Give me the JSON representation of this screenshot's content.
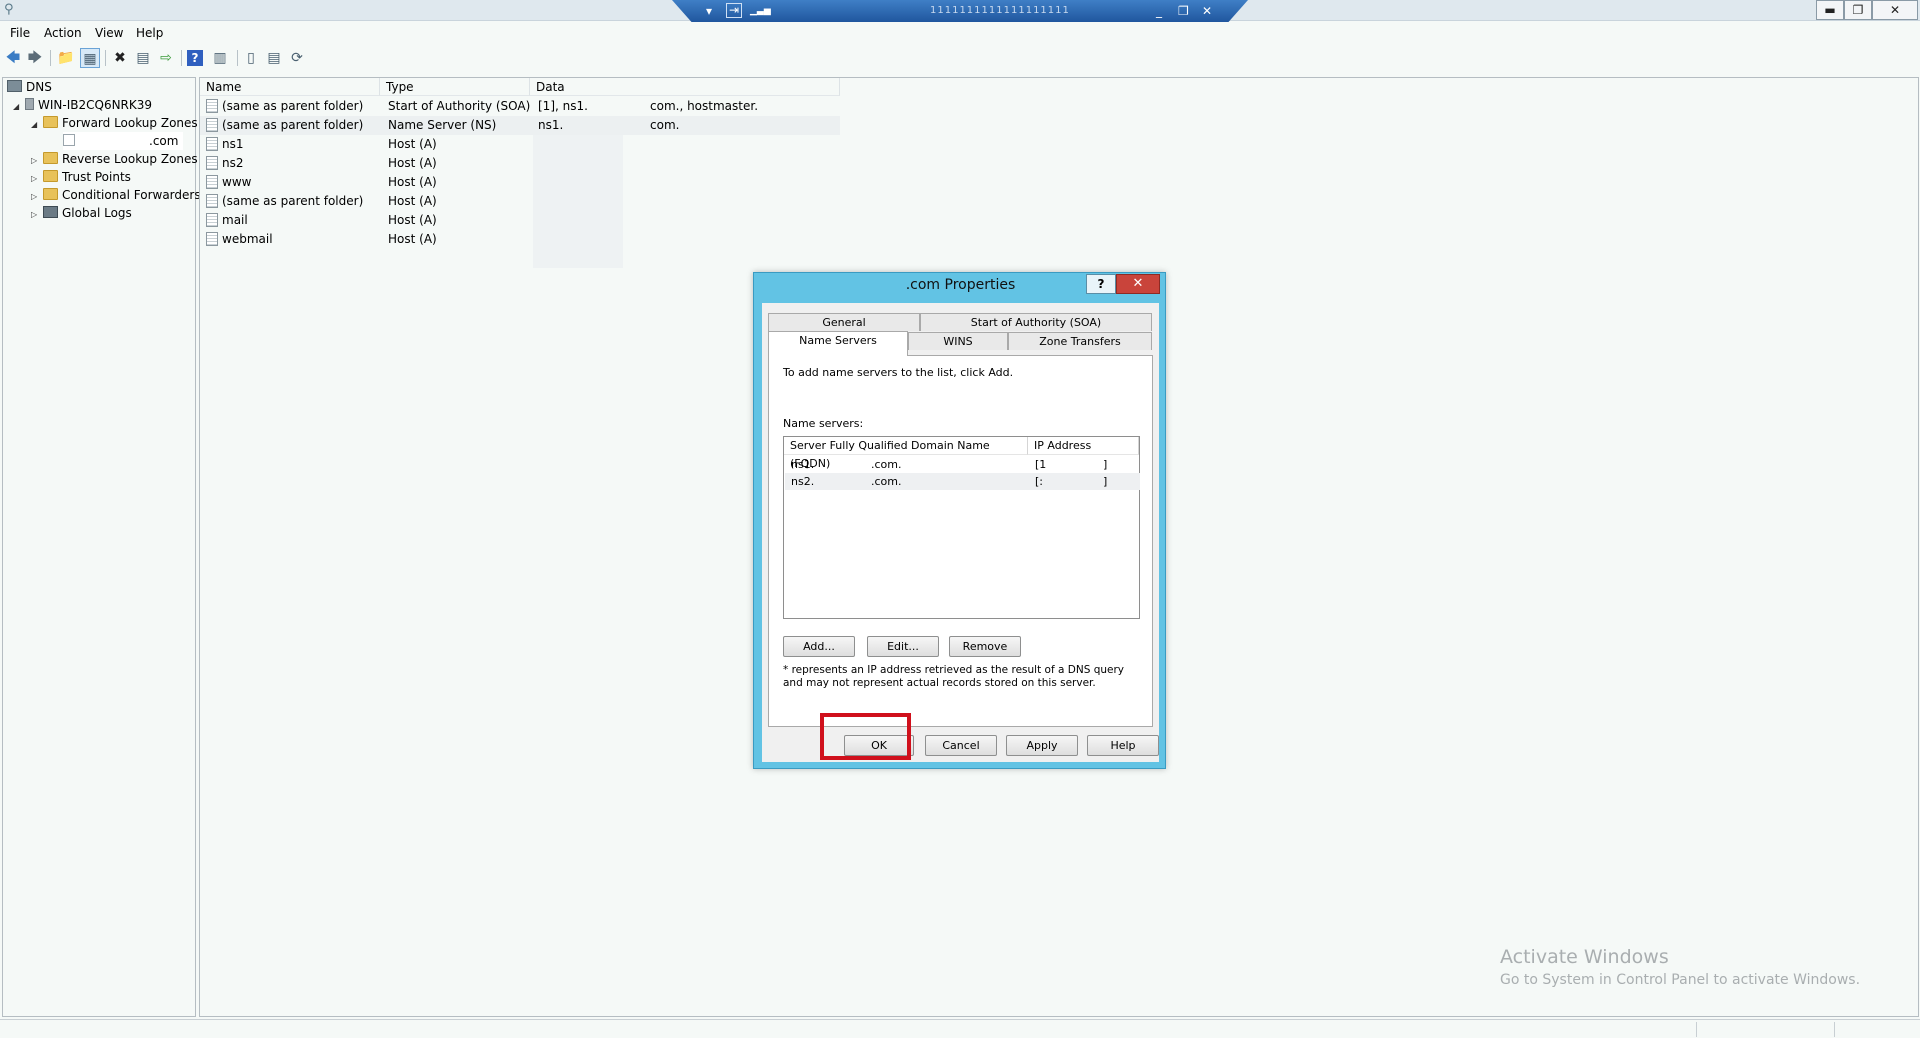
{
  "window": {
    "title_redacted": "1111111111111111111",
    "controls": {
      "minimize": "▬",
      "restore": "❐",
      "close": "✕"
    }
  },
  "rdp_bar": {
    "pin": "▾",
    "pin2": "⇥",
    "signal": "▁▃▅",
    "min": "_",
    "restore": "❐",
    "close": "✕"
  },
  "menu": {
    "file": "File",
    "action": "Action",
    "view": "View",
    "help": "Help"
  },
  "toolbar": {
    "back": "🡄",
    "forward": "🡆",
    "up": "📁",
    "show": "▦",
    "delete": "✖",
    "props": "▤",
    "export": "⇨",
    "help": "?",
    "console": "▥",
    "server": "▯",
    "list": "▤",
    "refresh": "⟳"
  },
  "tree": {
    "root": "DNS",
    "server": "WIN-IB2CQ6NRK39",
    "forward_zones": "Forward Lookup Zones",
    "zone": ".com",
    "reverse_zones": "Reverse Lookup Zones",
    "trust_points": "Trust Points",
    "conditional_forwarders": "Conditional Forwarders",
    "global_logs": "Global Logs",
    "expanded": "◢",
    "collapsed": "▷"
  },
  "list": {
    "columns": {
      "name": "Name",
      "type": "Type",
      "data": "Data"
    },
    "rows": [
      {
        "name": "(same as parent folder)",
        "type": "Start of Authority (SOA)",
        "data_a": "[1], ns1.",
        "data_b": "com., hostmaster."
      },
      {
        "name": "(same as parent folder)",
        "type": "Name Server (NS)",
        "data_a": "ns1.",
        "data_b": "com."
      },
      {
        "name": "ns1",
        "type": "Host (A)",
        "data_a": "",
        "data_b": ""
      },
      {
        "name": "ns2",
        "type": "Host (A)",
        "data_a": "",
        "data_b": ""
      },
      {
        "name": "www",
        "type": "Host (A)",
        "data_a": "",
        "data_b": ""
      },
      {
        "name": "(same as parent folder)",
        "type": "Host (A)",
        "data_a": "",
        "data_b": ""
      },
      {
        "name": "mail",
        "type": "Host (A)",
        "data_a": "",
        "data_b": ""
      },
      {
        "name": "webmail",
        "type": "Host (A)",
        "data_a": "",
        "data_b": ""
      }
    ]
  },
  "dialog": {
    "title": ".com Properties",
    "help": "?",
    "close": "✕",
    "tabs": {
      "general": "General",
      "soa": "Start of Authority (SOA)",
      "name_servers": "Name Servers",
      "wins": "WINS",
      "zone_transfers": "Zone Transfers"
    },
    "instruction": "To add name servers to the list, click Add.",
    "list_label": "Name servers:",
    "ns_columns": {
      "fqdn": "Server Fully Qualified Domain Name (FQDN)",
      "ip": "IP Address"
    },
    "ns_rows": [
      {
        "fqdn_a": "ns1.",
        "fqdn_b": ".com.",
        "ip_a": "[1",
        "ip_b": "]"
      },
      {
        "fqdn_a": "ns2.",
        "fqdn_b": ".com.",
        "ip_a": "[:",
        "ip_b": "]"
      }
    ],
    "buttons": {
      "add": "Add...",
      "edit": "Edit...",
      "remove": "Remove"
    },
    "note": "* represents an IP address retrieved as the result of a DNS query and may not represent actual records stored on this server.",
    "footer": {
      "ok": "OK",
      "cancel": "Cancel",
      "apply": "Apply",
      "help": "Help"
    }
  },
  "watermark": {
    "title": "Activate Windows",
    "subtitle": "Go to System in Control Panel to activate Windows."
  }
}
